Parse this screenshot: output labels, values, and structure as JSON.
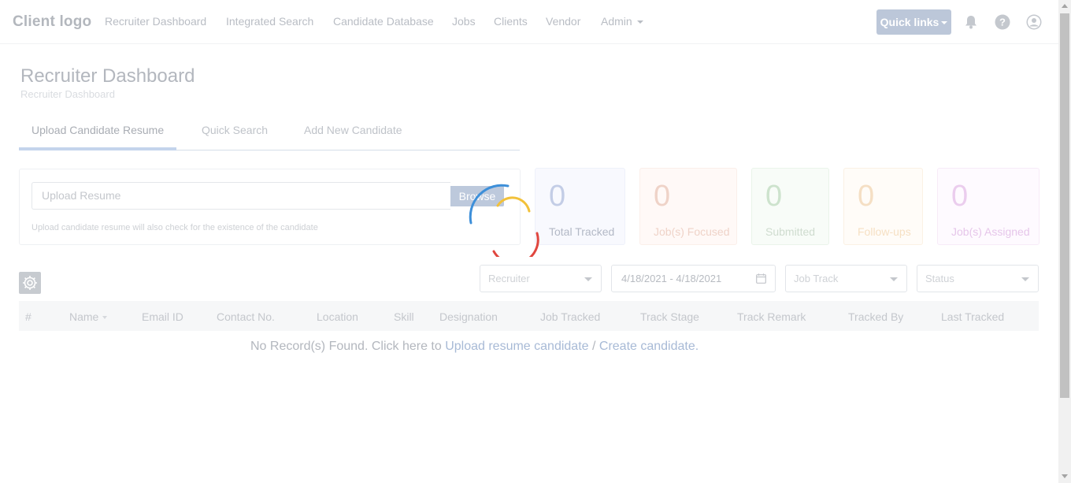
{
  "nav": {
    "brand": "Client logo",
    "items": [
      {
        "label": "Recruiter Dashboard"
      },
      {
        "label": "Integrated Search"
      },
      {
        "label": "Candidate Database"
      },
      {
        "label": "Jobs"
      },
      {
        "label": "Clients"
      },
      {
        "label": "Vendor"
      },
      {
        "label": "Admin"
      }
    ],
    "quick_links": "Quick links",
    "icons": [
      "bell-icon",
      "help-icon",
      "user-icon"
    ]
  },
  "page": {
    "title": "Recruiter Dashboard",
    "subtitle": "Recruiter Dashboard"
  },
  "tabs": [
    {
      "label": "Upload Candidate Resume",
      "active": true
    },
    {
      "label": "Quick Search",
      "active": false
    },
    {
      "label": "Add New Candidate",
      "active": false
    }
  ],
  "upload": {
    "placeholder": "Upload Resume",
    "browse_label": "Browse",
    "help_text": "Upload candidate resume will also check for the existence of the candidate"
  },
  "stats": [
    {
      "value": "0",
      "label": "Total Tracked",
      "color": "#c3cde6",
      "label_color": "#b3b9c6",
      "bg": "#f8f9fe",
      "border": "#eef1fa"
    },
    {
      "value": "0",
      "label": "Job(s) Focused",
      "color": "#efd3c8",
      "label_color": "#efd3c8",
      "bg": "#fff9f7",
      "border": "#fbefea"
    },
    {
      "value": "0",
      "label": "Submitted",
      "color": "#cde3cd",
      "label_color": "#cfdccf",
      "bg": "#f8fcf8",
      "border": "#eaf4ea"
    },
    {
      "value": "0",
      "label": "Follow-ups",
      "color": "#f5dfc4",
      "label_color": "#f6e0c3",
      "bg": "#fffcf8",
      "border": "#fbf1e4"
    },
    {
      "value": "0",
      "label": "Job(s) Assigned",
      "color": "#ebcdee",
      "label_color": "#e6c6ea",
      "bg": "#fefaff",
      "border": "#f7ebf8"
    }
  ],
  "filters": {
    "recruiter": "Recruiter",
    "date_range": "4/18/2021 - 4/18/2021",
    "job_track": "Job Track",
    "status": "Status"
  },
  "table": {
    "columns": [
      "#",
      "Name",
      "Email ID",
      "Contact No.",
      "Location",
      "Skill",
      "Designation",
      "Job Tracked",
      "Track Stage",
      "Track Remark",
      "Tracked By",
      "Last Tracked"
    ],
    "empty_prefix": "No Record(s) Found. Click here to ",
    "empty_link1": "Upload resume candidate",
    "empty_sep": " / ",
    "empty_link2": "Create candidate."
  },
  "colors": {
    "spinner_blue": "#3d8fd9",
    "spinner_yellow": "#f2c13a",
    "spinner_red": "#e0463e"
  }
}
